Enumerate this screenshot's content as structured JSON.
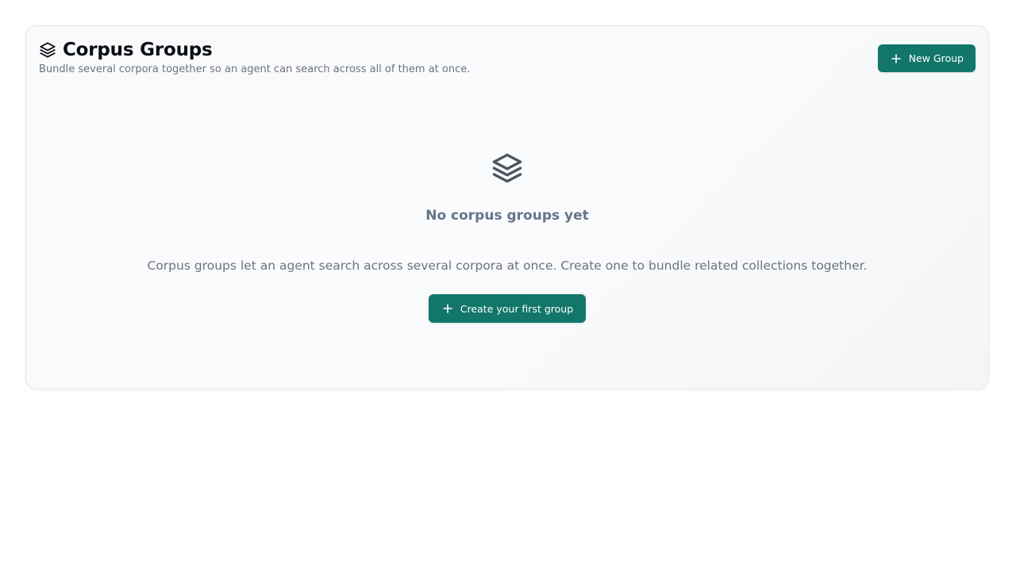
{
  "header": {
    "title": "Corpus Groups",
    "subtitle": "Bundle several corpora together so an agent can search across all of them at once.",
    "title_icon": "layers-icon",
    "new_group_label": "New Group",
    "new_group_icon": "plus-icon"
  },
  "empty_state": {
    "icon": "layers-icon",
    "title": "No corpus groups yet",
    "description": "Corpus groups let an agent search across several corpora at once. Create one to bundle related collections together.",
    "cta_label": "Create your first group",
    "cta_icon": "plus-icon"
  },
  "colors": {
    "accent": "#12766a",
    "title": "#0b0f14",
    "muted": "#6b7280",
    "empty_title": "#64748b",
    "empty_icon": "#4b5563"
  }
}
